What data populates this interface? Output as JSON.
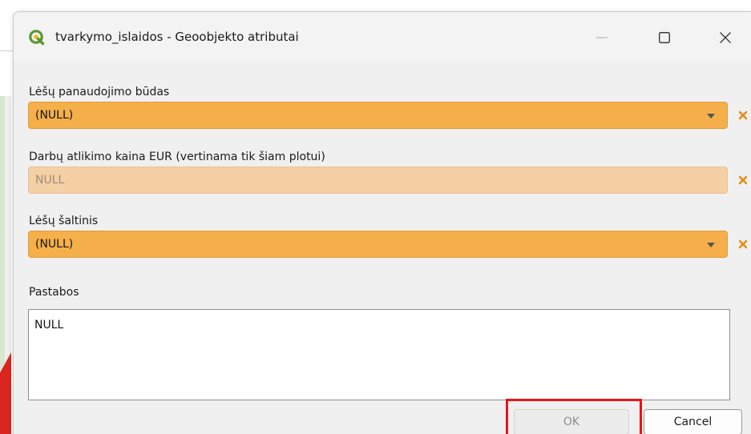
{
  "window": {
    "title": "tvarkymo_islaidos - Geoobjekto atributai",
    "app_icon": "qgis-logo-icon"
  },
  "colors": {
    "combo_fill": "#f5b04b",
    "input_fill": "#f5d0a4",
    "clear_icon": "#e88a10",
    "highlight": "#e8141b"
  },
  "form": {
    "field1": {
      "label": "Lėšų panaudojimo būdas",
      "value": "(NULL)"
    },
    "field2": {
      "label": "Darbų atlikimo kaina EUR (vertinama tik šiam plotui)",
      "placeholder": "NULL"
    },
    "field3": {
      "label": "Lėšų šaltinis",
      "value": "(NULL)"
    },
    "field4": {
      "label": "Pastabos",
      "value": "NULL"
    }
  },
  "buttons": {
    "ok": "OK",
    "cancel": "Cancel"
  }
}
